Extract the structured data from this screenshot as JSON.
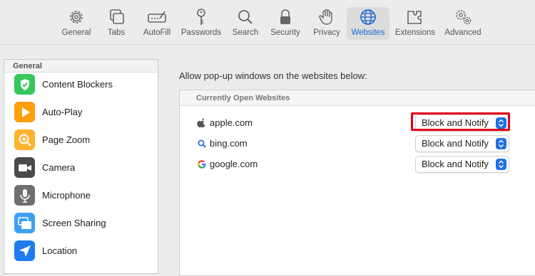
{
  "toolbar": {
    "items": [
      {
        "label": "General",
        "icon": "gear-icon"
      },
      {
        "label": "Tabs",
        "icon": "tabs-icon"
      },
      {
        "label": "AutoFill",
        "icon": "autofill-icon"
      },
      {
        "label": "Passwords",
        "icon": "key-icon"
      },
      {
        "label": "Search",
        "icon": "magnifier-icon"
      },
      {
        "label": "Security",
        "icon": "lock-icon"
      },
      {
        "label": "Privacy",
        "icon": "hand-icon"
      },
      {
        "label": "Websites",
        "icon": "globe-icon",
        "active": true
      },
      {
        "label": "Extensions",
        "icon": "puzzle-icon"
      },
      {
        "label": "Advanced",
        "icon": "gears-icon"
      }
    ],
    "active_color": "#1a66d8"
  },
  "sidebar": {
    "header": "General",
    "items": [
      {
        "label": "Content Blockers",
        "icon": "checkmark-shield-icon",
        "color": "#34c759"
      },
      {
        "label": "Auto-Play",
        "icon": "play-icon",
        "color": "#ff9f0a"
      },
      {
        "label": "Page Zoom",
        "icon": "zoom-icon",
        "color": "#ffb22e"
      },
      {
        "label": "Camera",
        "icon": "camera-icon",
        "color": "#4a4a4a"
      },
      {
        "label": "Microphone",
        "icon": "microphone-icon",
        "color": "#6e6e6e"
      },
      {
        "label": "Screen Sharing",
        "icon": "screen-sharing-icon",
        "color": "#3ea0f4"
      },
      {
        "label": "Location",
        "icon": "location-arrow-icon",
        "color": "#1f7cf0"
      }
    ]
  },
  "main": {
    "title": "Allow pop-up windows on the websites below:",
    "panel_header": "Currently Open Websites",
    "sites": [
      {
        "name": "apple.com",
        "icon": "apple-icon",
        "setting": "Block and Notify",
        "highlighted": true
      },
      {
        "name": "bing.com",
        "icon": "bing-search-icon",
        "setting": "Block and Notify"
      },
      {
        "name": "google.com",
        "icon": "google-icon",
        "setting": "Block and Notify"
      }
    ]
  },
  "highlight_color": "#e0001a"
}
